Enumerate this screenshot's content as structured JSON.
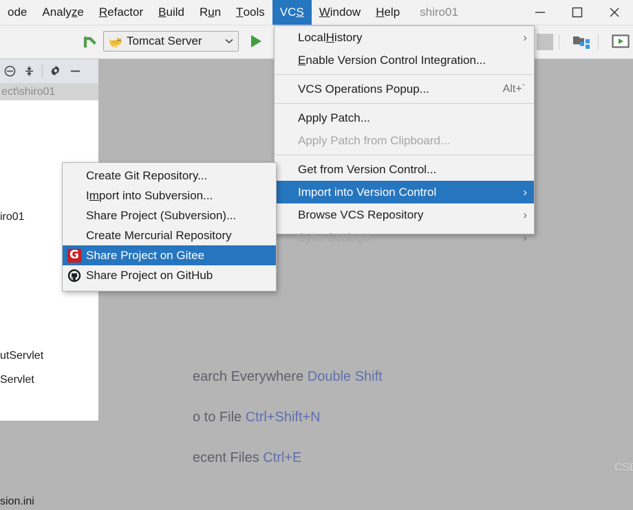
{
  "menubar": {
    "items": [
      {
        "pre": "",
        "mn": "",
        "post": "ode",
        "active": false
      },
      {
        "pre": "Analy",
        "mn": "z",
        "post": "e",
        "active": false
      },
      {
        "pre": "",
        "mn": "R",
        "post": "efactor",
        "active": false
      },
      {
        "pre": "",
        "mn": "B",
        "post": "uild",
        "active": false
      },
      {
        "pre": "R",
        "mn": "u",
        "post": "n",
        "active": false
      },
      {
        "pre": "",
        "mn": "T",
        "post": "ools",
        "active": false
      },
      {
        "pre": "VC",
        "mn": "S",
        "post": "",
        "active": true
      },
      {
        "pre": "",
        "mn": "W",
        "post": "indow",
        "active": false
      },
      {
        "pre": "",
        "mn": "H",
        "post": "elp",
        "active": false
      }
    ],
    "project_name": "shiro01",
    "window_controls": [
      {
        "name": "minimize-button",
        "glyph": "minimize"
      },
      {
        "name": "maximize-button",
        "glyph": "maximize"
      },
      {
        "name": "close-button",
        "glyph": "close"
      }
    ]
  },
  "toolbar": {
    "make_project_tooltip": "Make Project",
    "run_config": {
      "label": "Tomcat Server",
      "icon": "tomcat-cat-icon"
    },
    "run_button": "Run",
    "stop_button": "Stop",
    "structure_button": "Project Structure",
    "preview_button": "Open in Browser"
  },
  "project_panel": {
    "header_icons": [
      "collapse-all-icon",
      "expand-collapse-icon",
      "settings-gear-icon",
      "hide-panel-icon"
    ],
    "breadcrumb": "ect\\shiro01",
    "tree_rows": [
      {
        "label": ""
      },
      {
        "label": "iro01"
      },
      {
        "label": "utServlet"
      },
      {
        "label": "Servlet"
      },
      {
        "label": "sion.ini"
      }
    ]
  },
  "editor": {
    "hints": [
      {
        "text": "earch Everywhere ",
        "key": "Double Shift"
      },
      {
        "text": "o to File ",
        "key": "Ctrl+Shift+N"
      },
      {
        "text": "ecent Files ",
        "key": "Ctrl+E"
      }
    ],
    "watermark": "CSDN @夜雨微澜°"
  },
  "vcs_menu": {
    "items": [
      {
        "pre": "Local ",
        "mn": "H",
        "post": "istory",
        "accel": "",
        "arrow": true,
        "disabled": false,
        "selected": false
      },
      {
        "pre": "",
        "mn": "E",
        "post": "nable Version Control Integration...",
        "accel": "",
        "arrow": false,
        "disabled": false,
        "selected": false
      },
      {
        "sep": true
      },
      {
        "pre": "VCS Operations Popup...",
        "mn": "",
        "post": "",
        "accel": "Alt+`",
        "arrow": false,
        "disabled": false,
        "selected": false
      },
      {
        "sep": true
      },
      {
        "pre": "Apply Patch...",
        "mn": "",
        "post": "",
        "accel": "",
        "arrow": false,
        "disabled": false,
        "selected": false
      },
      {
        "pre": "Apply Patch from Clipboard...",
        "mn": "",
        "post": "",
        "accel": "",
        "arrow": false,
        "disabled": true,
        "selected": false
      },
      {
        "sep": true
      },
      {
        "pre": "Get from Version Control...",
        "mn": "",
        "post": "",
        "accel": "",
        "arrow": false,
        "disabled": false,
        "selected": false
      },
      {
        "pre": "Import into Version Control",
        "mn": "",
        "post": "",
        "accel": "",
        "arrow": true,
        "disabled": false,
        "selected": true
      },
      {
        "pre": "Browse VCS Repository",
        "mn": "",
        "post": "",
        "accel": "",
        "arrow": true,
        "disabled": false,
        "selected": false
      },
      {
        "pre": "Sync Settings",
        "mn": "",
        "post": "",
        "accel": "",
        "arrow": true,
        "disabled": true,
        "selected": false
      }
    ]
  },
  "vcs_submenu": {
    "items": [
      {
        "pre": "Create Git Repository...",
        "mn": "",
        "post": "",
        "icon": "",
        "selected": false
      },
      {
        "pre": "I",
        "mn": "m",
        "post": "port into Subversion...",
        "icon": "",
        "selected": false
      },
      {
        "pre": "Share Project (Subversion)...",
        "mn": "",
        "post": "",
        "icon": "",
        "selected": false
      },
      {
        "pre": "Create Mercurial Repository",
        "mn": "",
        "post": "",
        "icon": "",
        "selected": false
      },
      {
        "pre": "Share Project on Gitee",
        "mn": "",
        "post": "",
        "icon": "gitee-icon",
        "selected": true
      },
      {
        "pre": "Share Project on GitHub",
        "mn": "",
        "post": "",
        "icon": "github-icon",
        "selected": false
      }
    ]
  },
  "colors": {
    "accent": "#2675bf",
    "menu_bg": "#f2f2f2",
    "editor_bg": "#b5b5b5",
    "gitee_red": "#c71d23",
    "run_green": "#3f9e3f",
    "key_blue": "#5f6fae"
  }
}
